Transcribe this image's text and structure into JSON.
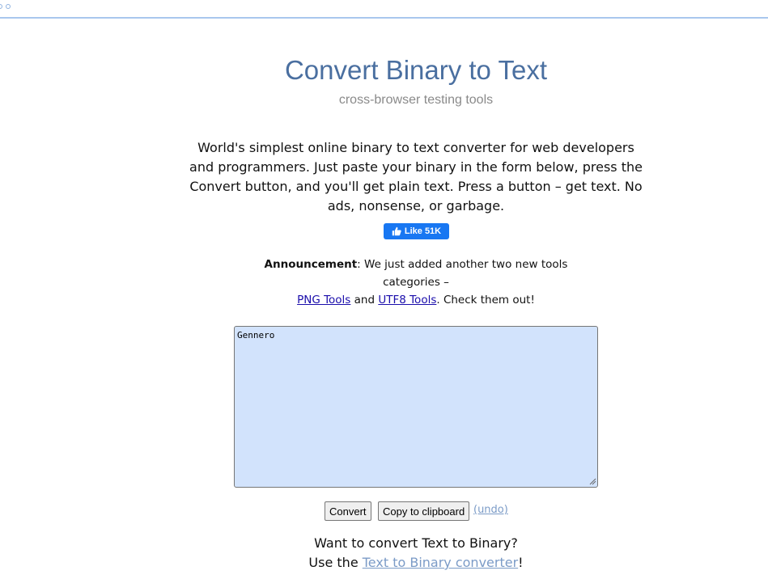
{
  "header": {
    "title": "Convert Binary to Text",
    "subtitle": "cross-browser testing tools"
  },
  "intro": {
    "text": "World's simplest online binary to text converter for web developers and programmers. Just paste your binary in the form below, press the Convert button, and you'll get plain text. Press a button – get text. No ads, nonsense, or garbage."
  },
  "facebook": {
    "like_label": "Like 51K",
    "icon": "thumbs-up-icon",
    "color": "#1877f2"
  },
  "announcement": {
    "label": "Announcement",
    "text_before": ": We just added another two new tools categories –",
    "link1": "PNG Tools",
    "between": " and ",
    "link2": "UTF8 Tools",
    "text_after": ". Check them out!"
  },
  "editor": {
    "value": "Gennero",
    "background": "#d2e3fc"
  },
  "actions": {
    "convert_label": "Convert",
    "copy_label": "Copy to clipboard",
    "undo_label": "(undo)"
  },
  "footer": {
    "question": "Want to convert Text to Binary?",
    "use_the": "Use the ",
    "link": "Text to Binary converter",
    "end": "!"
  }
}
